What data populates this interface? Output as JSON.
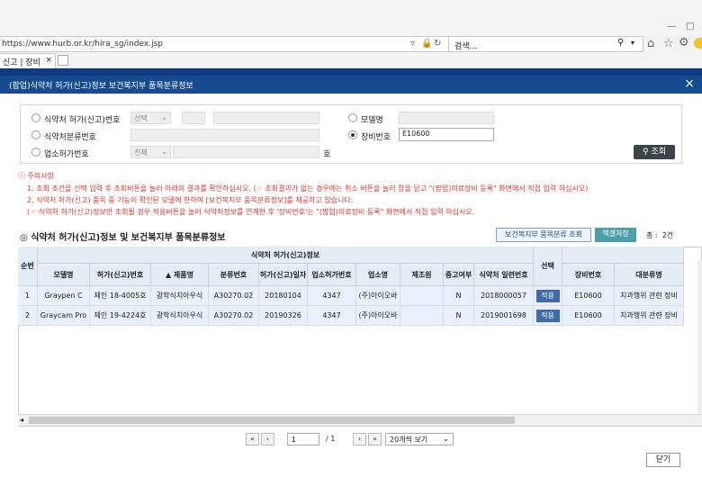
{
  "browser": {
    "url": "https://www.hurb.or.kr/hira_sg/index.jsp",
    "search_placeholder": "검색...",
    "tab_title": "신고 | 장비현..."
  },
  "modal": {
    "title": "(팝업)식약처 허가(신고)정보 보건복지부 품목분류정보",
    "close_label": "닫기"
  },
  "search": {
    "left": [
      {
        "label": "식약처 허가(신고)번호",
        "select": "선택",
        "selected": false
      },
      {
        "label": "식약처분류번호",
        "selected": false
      },
      {
        "label": "업소허가번호",
        "select": "전체",
        "suffix": "호",
        "selected": false
      }
    ],
    "right": [
      {
        "label": "모델명",
        "value": "",
        "selected": false
      },
      {
        "label": "장비번호",
        "value": "E10600",
        "selected": true
      }
    ],
    "button_label": "조회"
  },
  "notice": {
    "title": "주의사항",
    "lines": [
      {
        "text": "1. 조회 조건을 선택 입력 후 조회버튼을 눌러 아래의 결과를 확인하십시오. (☞ 조회결과가 없는 경우에는 취소 버튼을 눌러 창을 닫고 \"(팝업)의료장비 등록\" 화면에서 직접 입력 하십시오)",
        "color": "#d9342b"
      },
      {
        "text": "2. 식약처 허가(신고) 품목 중 기능이 확인된 모델에 한하여 [보건복지부 품목분류정보]를 제공하고 있습니다.",
        "color": "#d9342b"
      },
      {
        "text": "(☞ 식약처 허가(신고)정보만 조회될 경우 적용버튼을 눌러 식약처정보를 연계한 후 '장비번호'는 \"(팝업)의료장비 등록\" 화면에서 직접 입력 하십시오.",
        "color": "#d9342b"
      }
    ]
  },
  "section": {
    "title": "식약처 허가(신고)정보 및 보건복지부 품목분류정보",
    "btn_mohw": "보건복지부 품목분류 조회",
    "btn_excel": "엑셀저장",
    "count_label": "총 :",
    "count": "2건"
  },
  "table": {
    "group_header": "식약처 허가(신고)정보",
    "headers": [
      "순번",
      "모델명",
      "허가(신고)번호",
      "▲ 제품명",
      "분류번호",
      "허가(신고)일자",
      "업소허가번호",
      "업소명",
      "제조원",
      "중고여부",
      "식약처 일련번호",
      "선택",
      "장비번호",
      "대분류명"
    ],
    "apply_label": "적용",
    "rows": [
      [
        "1",
        "Graypen C",
        "제인 18-4005호",
        "광학식치아우식",
        "A30270.02",
        "20180104",
        "4347",
        "(주)아이오바",
        "",
        "N",
        "2018000057",
        "",
        "E10600",
        "치과행위 관련 장비"
      ],
      [
        "2",
        "Graycam Pro",
        "제인 19-4224호",
        "광학식치아우식",
        "A30270.02",
        "20190326",
        "4347",
        "(주)아이오바",
        "",
        "N",
        "2019001698",
        "",
        "E10600",
        "치과행위 관련 장비"
      ]
    ]
  },
  "pager": {
    "first": "«",
    "prev": "‹",
    "next": "›",
    "last": "»",
    "page": "1",
    "total": "/ 1",
    "per_page": "20개씩 보기"
  }
}
